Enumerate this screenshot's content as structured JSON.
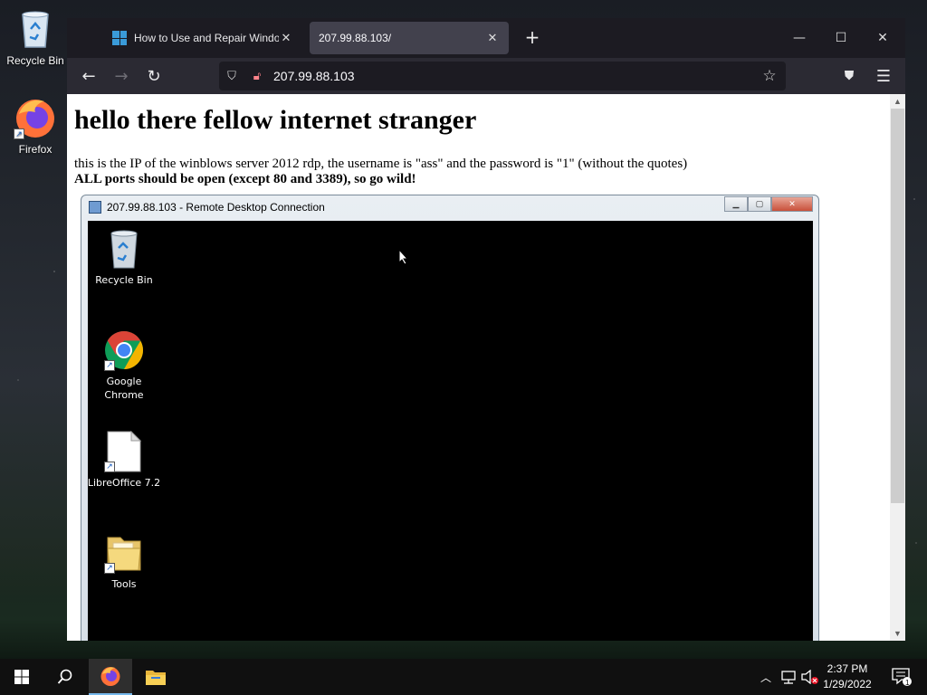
{
  "desktop": {
    "icons": [
      {
        "label": "Recycle Bin",
        "icon": "recycle-bin-icon"
      },
      {
        "label": "Firefox",
        "icon": "firefox-icon"
      }
    ]
  },
  "browser": {
    "tabs": [
      {
        "title": "How to Use and Repair Windows",
        "icon": "windows-logo-icon",
        "active": false
      },
      {
        "title": "207.99.88.103/",
        "active": true
      }
    ],
    "new_tab_icon": "plus-icon",
    "window_controls": [
      "minimize-icon",
      "maximize-icon",
      "close-icon"
    ],
    "url": "207.99.88.103",
    "toolbar_icons": [
      "back-arrow-icon",
      "forward-arrow-icon",
      "reload-icon",
      "shield-icon",
      "lock-icon",
      "star-icon",
      "pocket-icon",
      "menu-icon"
    ]
  },
  "page": {
    "heading": "hello there fellow internet stranger",
    "line1": "this is the IP of the winblows server 2012 rdp, the username is \"ass\" and the password is \"1\" (without the quotes)",
    "line2": "ALL ports should be open (except 80 and 3389), so go wild!"
  },
  "rdp": {
    "title": "207.99.88.103 - Remote Desktop Connection",
    "icons": [
      {
        "label": "Recycle Bin",
        "icon": "recycle-bin-icon"
      },
      {
        "label": "Google Chrome",
        "icon": "chrome-icon"
      },
      {
        "label": "LibreOffice 7.2",
        "icon": "document-icon"
      },
      {
        "label": "Tools",
        "icon": "folder-icon"
      }
    ]
  },
  "taskbar": {
    "time": "2:37 PM",
    "date": "1/29/2022",
    "notification_count": "1"
  },
  "colors": {
    "accent": "#1b5fc1",
    "firefox_orange": "#ff7139",
    "chrome_red": "#db4437",
    "chrome_yellow": "#f4b400",
    "chrome_green": "#0f9d58"
  }
}
